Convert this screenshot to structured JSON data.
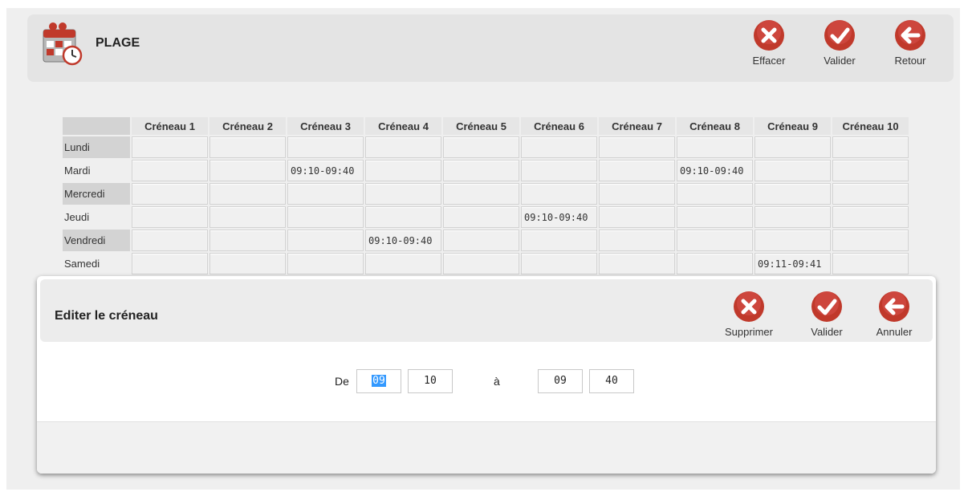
{
  "app": {
    "title": "PLAGE",
    "logo_icon": "calendar-clock-icon"
  },
  "toolbar": {
    "buttons": [
      {
        "label": "Effacer",
        "icon": "close-icon",
        "color": "#c0392b"
      },
      {
        "label": "Valider",
        "icon": "check-icon",
        "color": "#c0392b"
      },
      {
        "label": "Retour",
        "icon": "arrow-left-icon",
        "color": "#c0392b"
      }
    ]
  },
  "grid": {
    "headers": [
      "Créneau 1",
      "Créneau 2",
      "Créneau 3",
      "Créneau 4",
      "Créneau 5",
      "Créneau 6",
      "Créneau 7",
      "Créneau 8",
      "Créneau 9",
      "Créneau 10"
    ],
    "rows": [
      {
        "day": "Lundi",
        "slots": [
          "",
          "",
          "",
          "",
          "",
          "",
          "",
          "",
          "",
          ""
        ]
      },
      {
        "day": "Mardi",
        "slots": [
          "",
          "",
          "09:10-09:40",
          "",
          "",
          "",
          "",
          "09:10-09:40",
          "",
          ""
        ]
      },
      {
        "day": "Mercredi",
        "slots": [
          "",
          "",
          "",
          "",
          "",
          "",
          "",
          "",
          "",
          ""
        ]
      },
      {
        "day": "Jeudi",
        "slots": [
          "",
          "",
          "",
          "",
          "",
          "09:10-09:40",
          "",
          "",
          "",
          ""
        ]
      },
      {
        "day": "Vendredi",
        "slots": [
          "",
          "",
          "",
          "09:10-09:40",
          "",
          "",
          "",
          "",
          "",
          ""
        ]
      },
      {
        "day": "Samedi",
        "slots": [
          "",
          "",
          "",
          "",
          "",
          "",
          "",
          "",
          "09:11-09:41",
          ""
        ]
      }
    ]
  },
  "dialog": {
    "title": "Editer le créneau",
    "buttons": [
      {
        "label": "Supprimer",
        "icon": "close-icon"
      },
      {
        "label": "Valider",
        "icon": "check-icon"
      },
      {
        "label": "Annuler",
        "icon": "arrow-left-icon"
      }
    ],
    "from_label": "De",
    "to_label": "à",
    "separator": ":",
    "from_hour": "09",
    "from_minute": "10",
    "to_hour": "09",
    "to_minute": "40"
  }
}
